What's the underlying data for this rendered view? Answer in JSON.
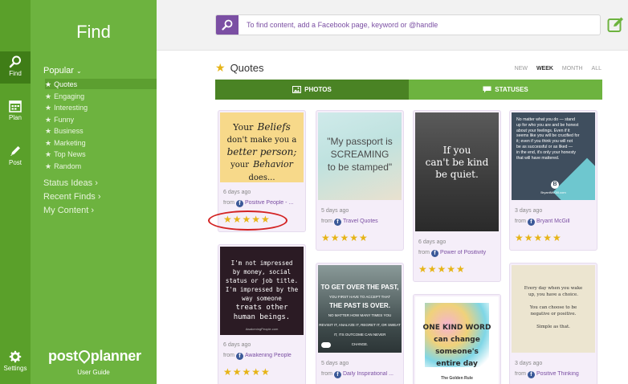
{
  "rail": {
    "find": "Find",
    "plan": "Plan",
    "post": "Post",
    "settings": "Settings"
  },
  "sidebar": {
    "title": "Find",
    "popular": "Popular",
    "sub_items": [
      "Quotes",
      "Engaging",
      "Interesting",
      "Funny",
      "Business",
      "Marketing",
      "Top News",
      "Random"
    ],
    "ideas": "Status Ideas",
    "recent": "Recent Finds",
    "content": "My Content",
    "logo_left": "post",
    "logo_right": "planner",
    "user_guide": "User Guide"
  },
  "search": {
    "placeholder": "To find content, add a Facebook page, keyword or @handle"
  },
  "main": {
    "heading": "Quotes",
    "filters": [
      "NEW",
      "WEEK",
      "MONTH",
      "ALL"
    ],
    "selected_filter": "WEEK",
    "tab_photos": "PHOTOS",
    "tab_statuses": "STATUSES"
  },
  "cards": [
    {
      "date": "6 days ago",
      "from": "from",
      "source": "Positive People - ...",
      "stars": "★★★★★",
      "quote": {
        "l1": "Your",
        "l2": "Beliefs",
        "l3": "don't make you a",
        "l4": "better person;",
        "l5": "your",
        "l6": "Behavior",
        "l7": "does..."
      }
    },
    {
      "date": "5 days ago",
      "from": "from",
      "source": "Travel Quotes",
      "stars": "★★★★★",
      "quote": {
        "l1": "\"My passport is",
        "l2": "SCREAMING",
        "l3": "to be stamped\""
      }
    },
    {
      "date": "6 days ago",
      "from": "from",
      "source": "Power of Positivity",
      "stars": "★★★★★",
      "quote": {
        "l1": "If you",
        "l2": "can't be kind",
        "l3": "be quiet."
      }
    },
    {
      "date": "3 days ago",
      "from": "from",
      "source": "Bryant McGill",
      "stars": "★★★★★",
      "quote": {
        "l1": "No matter what you do — stand",
        "l2": "up for who you are and be honest",
        "l3": "about your feelings. Even if it",
        "l4": "seems like you will be crucified for",
        "l5": "it; even if you think you will not",
        "l6": "be as successful or as liked —",
        "l7": "in the end, it's only your honesty",
        "l8": "that will have mattered.",
        "l9": "BryantMcGill.com"
      }
    },
    {
      "date": "6 days ago",
      "from": "from",
      "source": "Awakening People",
      "stars": "★★★★★",
      "quote": {
        "l1": "I'm not impressed",
        "l2": "by money, social",
        "l3": "status or job title.",
        "l4": "I'm impressed by the",
        "l5": "way someone",
        "l6": "treats other",
        "l7": "human beings.",
        "l8": "AwakeningPeople.com"
      }
    },
    {
      "date": "5 days ago",
      "from": "from",
      "source": "Daily Inspirational ...",
      "stars": "",
      "quote": {
        "l1": "TO GET OVER THE PAST,",
        "l2": "YOU FIRST HAVE TO ACCEPT THAT",
        "l3": "THE PAST IS OVER.",
        "l4": "NO MATTER HOW MANY TIMES YOU",
        "l5": "REVISIT IT, ANALYZE IT, REGRET IT, OR SWEAT",
        "l6": "IT, ITS OUTCOME CAN NEVER",
        "l7": "CHANGE."
      }
    },
    {
      "date": "",
      "from": "",
      "source": "",
      "stars": "",
      "quote": {
        "l1": "ONE KIND WORD",
        "l2": "can change",
        "l3": "someone's",
        "l4": "entire day",
        "l5": "The Golden Rule"
      }
    },
    {
      "date": "3 days ago",
      "from": "from",
      "source": "Positive Thinking",
      "stars": "",
      "quote": {
        "l1": "Every day when you wake",
        "l2": "up, you have a choice.",
        "l3": "You can choose to be",
        "l4": "negative or positive.",
        "l5": "Simple as that."
      }
    }
  ]
}
